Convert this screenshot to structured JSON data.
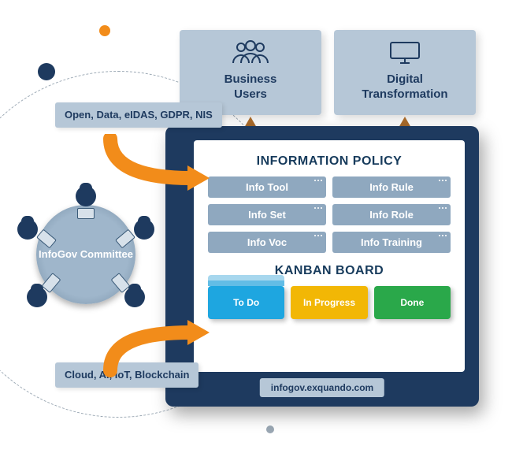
{
  "top_cards": {
    "business": {
      "label": "Business\nUsers"
    },
    "digital": {
      "label": "Digital\nTransformation"
    }
  },
  "board": {
    "policy_title": "INFORMATION POLICY",
    "cells": [
      "Info Tool",
      "Info Rule",
      "Info Set",
      "Info Role",
      "Info Voc",
      "Info Training"
    ],
    "kanban_title": "KANBAN BOARD",
    "kanban": {
      "todo": "To Do",
      "inprog": "In Progress",
      "done": "Done"
    },
    "url": "infogov.exquando.com"
  },
  "left_boxes": {
    "top": "Open, Data, eIDAS, GDPR, NIS",
    "bottom": "Cloud, AI, IoT, Blockchain"
  },
  "committee_label": "InfoGov Committee",
  "colors": {
    "navy": "#1e3a5f",
    "slate": "#b6c7d7",
    "orange": "#f28c1a",
    "blue": "#1ea6e0",
    "yellow": "#f2b705",
    "green": "#2aa84a"
  }
}
